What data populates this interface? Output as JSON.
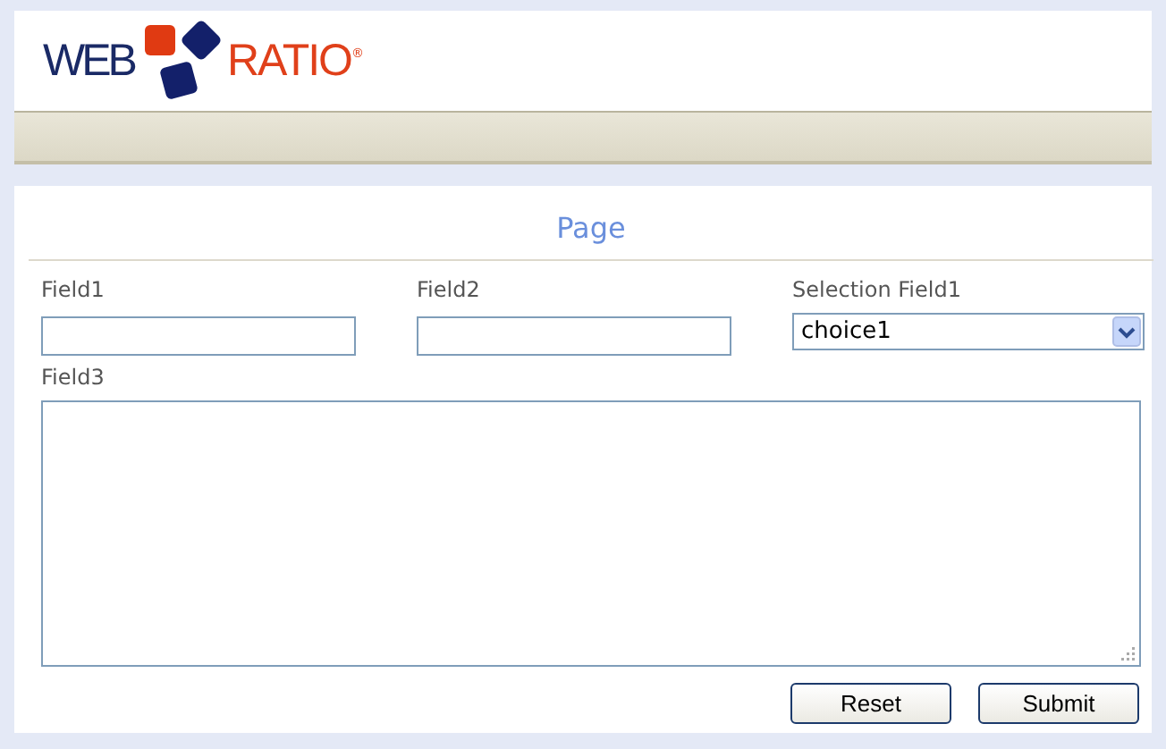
{
  "logo": {
    "left": "WEB",
    "right": "RATIO",
    "mark": "®"
  },
  "page": {
    "title": "Page",
    "fields": [
      {
        "kind": "text",
        "label": "Field1"
      },
      {
        "kind": "text",
        "label": "Field2"
      },
      {
        "kind": "select",
        "label": "Selection Field1",
        "value": "choice1"
      }
    ],
    "textarea": {
      "label": "Field3"
    },
    "buttons": [
      "Reset",
      "Submit"
    ]
  }
}
